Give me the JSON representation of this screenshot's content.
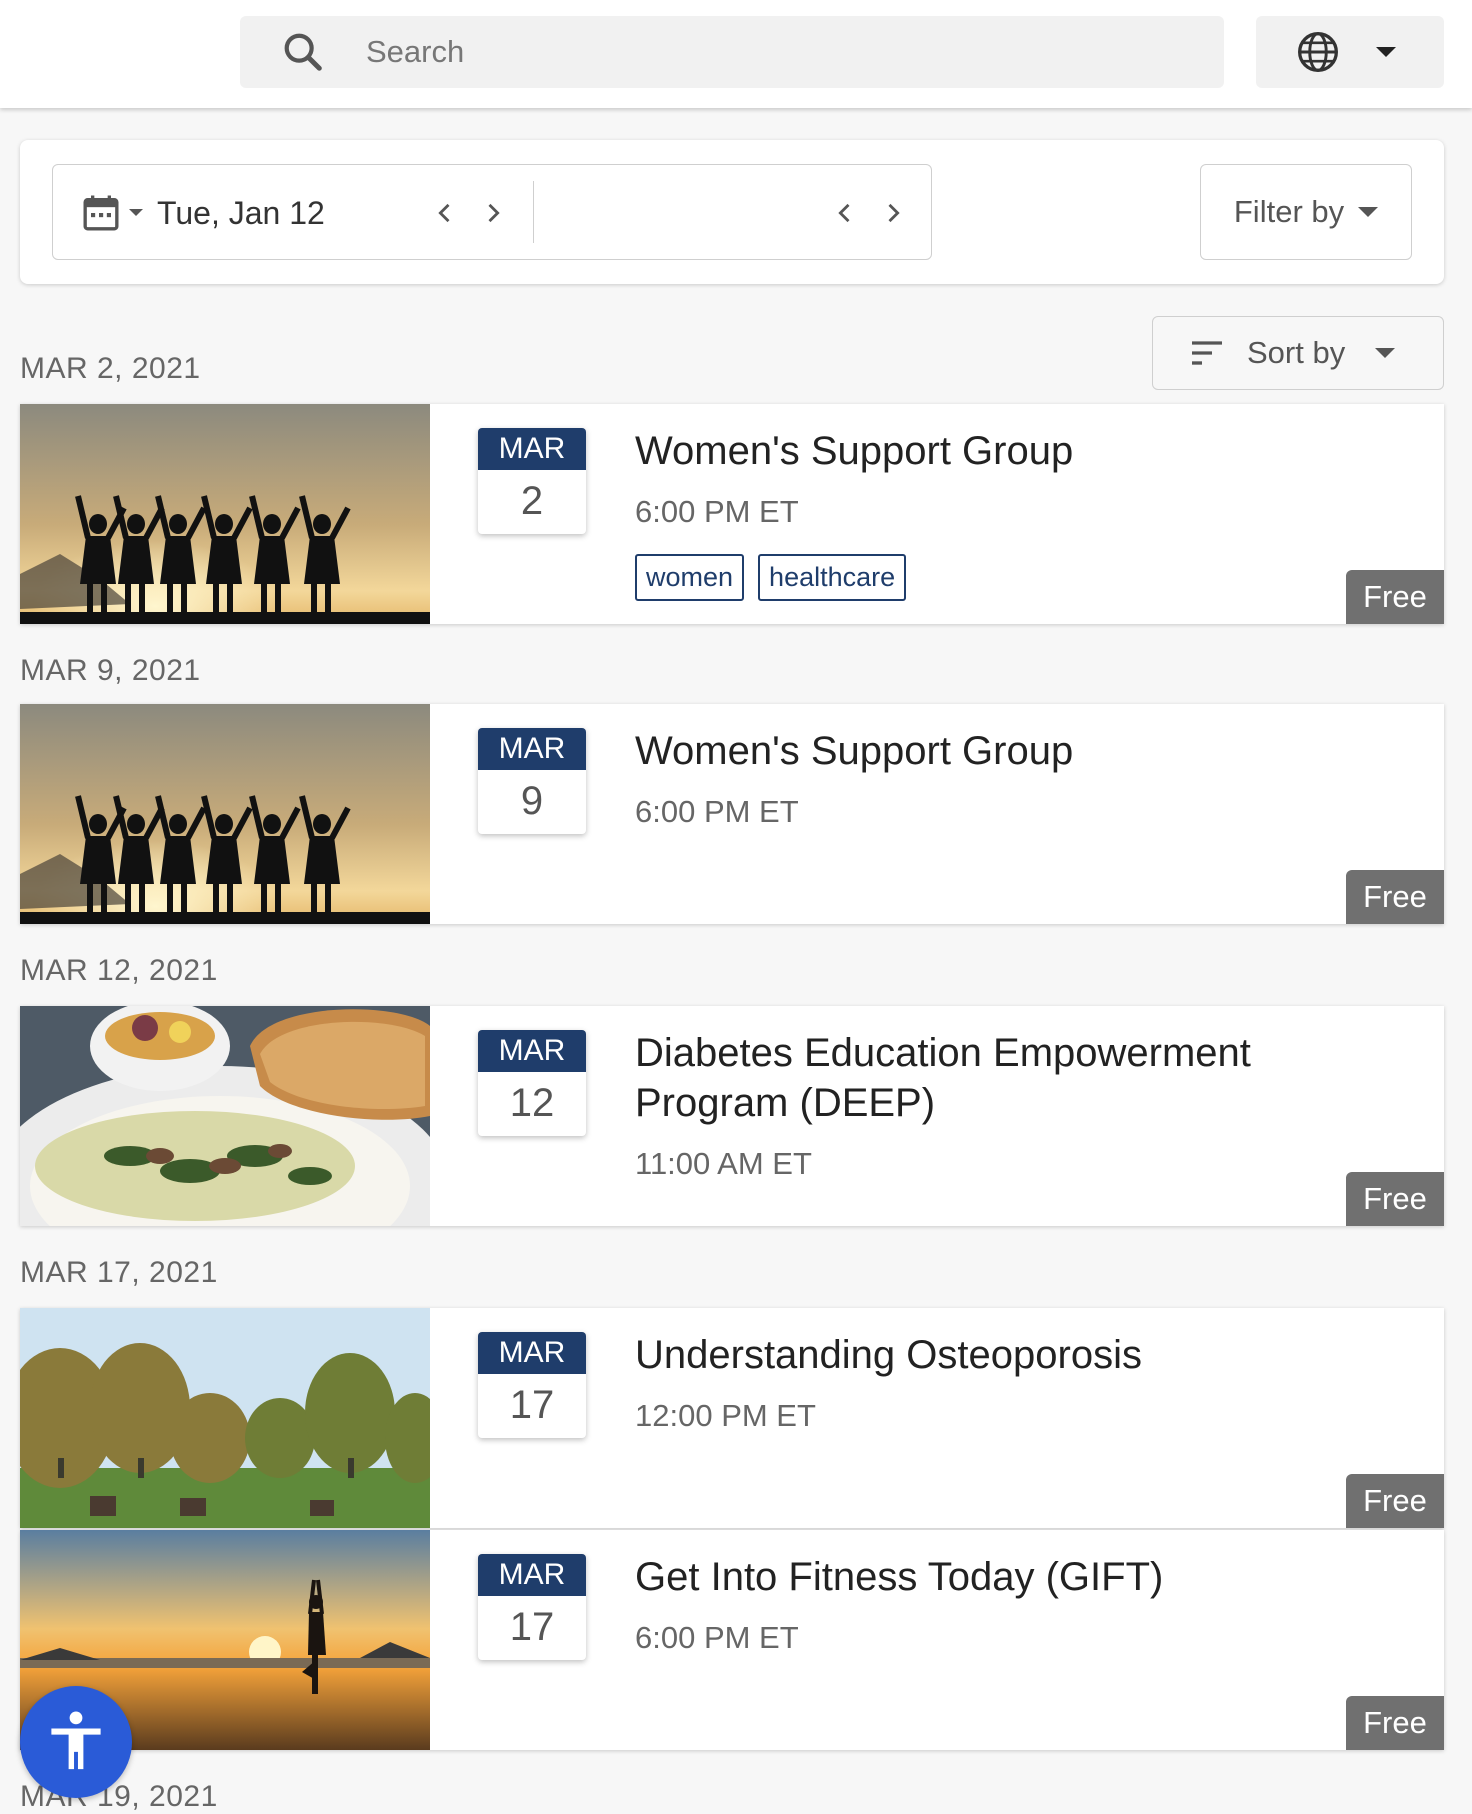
{
  "header": {
    "search": {
      "placeholder": "Search"
    },
    "language_icon": "globe-icon"
  },
  "filters": {
    "date_value": "Tue, Jan 12",
    "filter_label": "Filter by",
    "sort_label": "Sort by"
  },
  "events": [
    {
      "date_heading": "MAR 2, 2021",
      "month": "MAR",
      "day": "2",
      "title": "Women's Support Group",
      "time": "6:00 PM ET",
      "tags": [
        "women",
        "healthcare"
      ],
      "price": "Free",
      "image": "sunset-silhouettes-photo"
    },
    {
      "date_heading": "MAR 9, 2021",
      "month": "MAR",
      "day": "9",
      "title": "Women's Support Group",
      "time": "6:00 PM ET",
      "price": "Free",
      "image": "sunset-silhouettes-photo"
    },
    {
      "date_heading": "MAR 12, 2021",
      "month": "MAR",
      "day": "12",
      "title": "Diabetes Education Empowerment Program (DEEP)",
      "time": "11:00 AM ET",
      "price": "Free",
      "image": "breakfast-plate-photo"
    },
    {
      "date_heading": "MAR 17, 2021",
      "month": "MAR",
      "day": "17",
      "title": "Understanding Osteoporosis",
      "time": "12:00 PM ET",
      "price": "Free",
      "image": "park-trees-photo"
    },
    {
      "month": "MAR",
      "day": "17",
      "title": "Get Into Fitness Today (GIFT)",
      "time": "6:00 PM ET",
      "price": "Free",
      "image": "beach-yoga-sunset-photo"
    }
  ],
  "next_date_heading": "MAR 19, 2021",
  "colors": {
    "accent": "#1f3d6b",
    "price_badge": "#707070",
    "accessibility_button": "#2a5bd7"
  }
}
